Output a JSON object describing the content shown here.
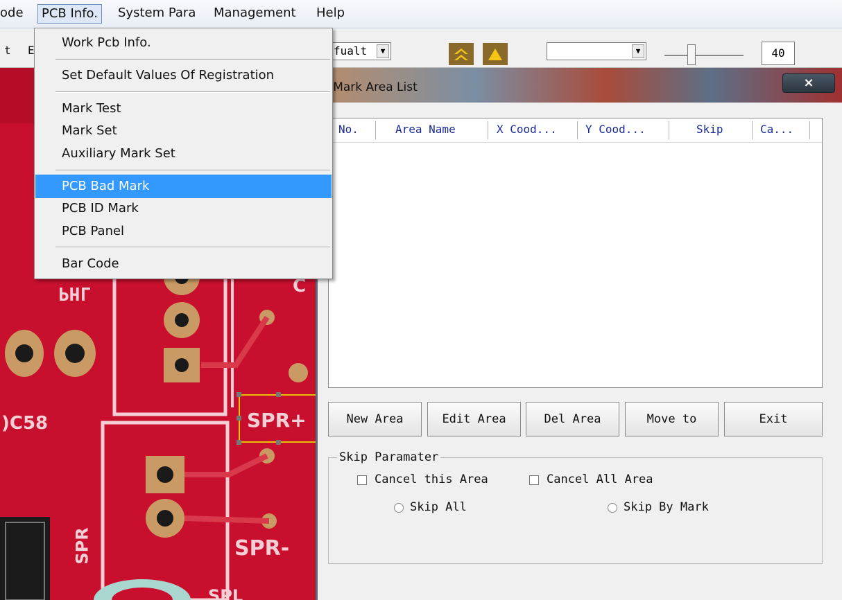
{
  "menubar": {
    "items": [
      {
        "label": "ode"
      },
      {
        "label": "PCB Info."
      },
      {
        "label": "System Para"
      },
      {
        "label": "Management"
      },
      {
        "label": "Help"
      }
    ]
  },
  "toolbar": {
    "left_text_1": "t",
    "left_text_2": "E",
    "combo_value": "fualt",
    "combo2_value": "",
    "number_value": "40"
  },
  "pcb_info_menu": {
    "items": [
      {
        "label": "Work Pcb Info."
      },
      {
        "label": "Set Default Values Of Registration"
      },
      {
        "label": "Mark Test"
      },
      {
        "label": "Mark Set"
      },
      {
        "label": "Auxiliary Mark Set"
      },
      {
        "label": "PCB Bad Mark"
      },
      {
        "label": "PCB ID Mark"
      },
      {
        "label": "PCB Panel"
      },
      {
        "label": "Bar Code"
      }
    ]
  },
  "pcb_labels": {
    "phl": "PHL",
    "c58": ")C58",
    "sprp": "SPR+",
    "sprm": "SPR-",
    "spr": "SPR",
    "c": "C",
    "spl": "SPL"
  },
  "dialog": {
    "title": "d Mark Area List",
    "close_label": "×",
    "columns": [
      "No.",
      "Area Name",
      "X Cood...",
      "Y Cood...",
      "Skip",
      "Ca..."
    ],
    "buttons": {
      "new_area": "New Area",
      "edit_area": "Edit Area",
      "del_area": "Del Area",
      "move_to": "Move to",
      "exit": "Exit"
    },
    "skip_group": {
      "title": "Skip Paramater",
      "cancel_this_area": "Cancel this Area",
      "cancel_all_area": "Cancel All Area",
      "skip_all": "Skip All",
      "skip_by_mark": "Skip By Mark"
    }
  },
  "colors": {
    "menu_highlight": "#3399ff",
    "pcb_red": "#c8102e",
    "column_text": "#1a2a9a"
  }
}
